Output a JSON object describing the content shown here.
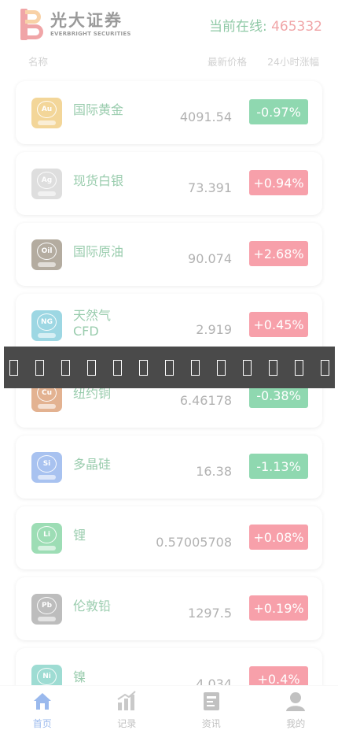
{
  "header": {
    "brand_cn": "光大证券",
    "brand_en": "EVERBRIGHT SECURITIES",
    "online_label": "当前在线: ",
    "online_count": "465332"
  },
  "columns": {
    "name": "名称",
    "price": "最新价格",
    "change": "24小时涨幅"
  },
  "items": [
    {
      "symbol": "Au",
      "name": "国际黄金",
      "price": "4091.54",
      "change": "-0.97%",
      "dir": "down",
      "color": "#e5a520"
    },
    {
      "symbol": "Ag",
      "name": "现货白银",
      "price": "73.391",
      "change": "+0.94%",
      "dir": "up",
      "color": "#b7b7b7"
    },
    {
      "symbol": "Oil",
      "name": "国际原油",
      "price": "90.074",
      "change": "+2.68%",
      "dir": "up",
      "color": "#5a4a2e"
    },
    {
      "symbol": "NG",
      "name": "天然气CFD",
      "price": "2.919",
      "change": "+0.45%",
      "dir": "up",
      "color": "#27a7c3"
    },
    {
      "symbol": "Cu",
      "name": "纽约铜",
      "price": "6.46178",
      "change": "-0.38%",
      "dir": "down",
      "color": "#c2560e"
    },
    {
      "symbol": "Si",
      "name": "多晶硅",
      "price": "16.38",
      "change": "-1.13%",
      "dir": "down",
      "color": "#3f7ae0"
    },
    {
      "symbol": "Li",
      "name": "锂",
      "price": "0.57005708",
      "change": "+0.08%",
      "dir": "up",
      "color": "#27b55c"
    },
    {
      "symbol": "Pb",
      "name": "伦敦铅",
      "price": "1297.5",
      "change": "+0.19%",
      "dir": "up",
      "color": "#6f6f6f"
    },
    {
      "symbol": "Ni",
      "name": "镍",
      "price": "4.034",
      "change": "+0.4%",
      "dir": "up",
      "color": "#2bb3a0"
    }
  ],
  "tabs": [
    {
      "label": "首页",
      "icon": "home-icon",
      "active": true
    },
    {
      "label": "记录",
      "icon": "chart-icon",
      "active": false
    },
    {
      "label": "资讯",
      "icon": "news-icon",
      "active": false
    },
    {
      "label": "我的",
      "icon": "user-icon",
      "active": false
    }
  ],
  "toast": {
    "glyph_count": 13
  }
}
